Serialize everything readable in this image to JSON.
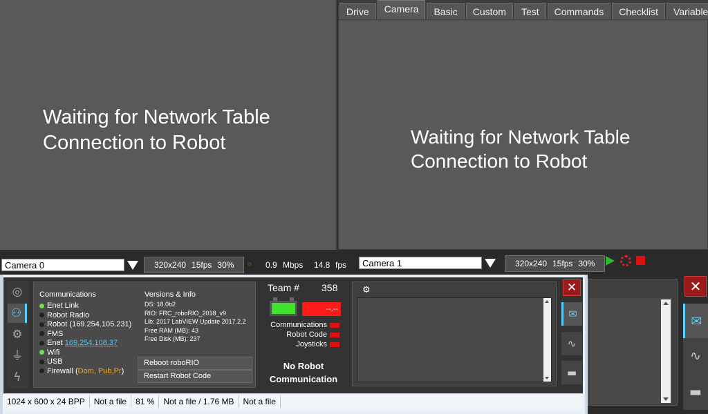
{
  "tabs": [
    "Drive",
    "Camera",
    "Basic",
    "Custom",
    "Test",
    "Commands",
    "Checklist",
    "Variables"
  ],
  "active_tab": "Camera",
  "camera_left": {
    "waiting_line1": "Waiting for Network Table",
    "waiting_line2": "Connection to Robot",
    "select_value": "Camera 0",
    "resolution": "320x240",
    "fps": "15fps",
    "quality": "30%"
  },
  "camera_right": {
    "waiting_line1": "Waiting for Network Table",
    "waiting_line2": "Connection to Robot",
    "select_value": "Camera 1",
    "resolution": "320x240",
    "fps": "15fps",
    "quality": "30%"
  },
  "bandwidth": {
    "value": "0.9",
    "unit": "Mbps",
    "fps_value": "14.8",
    "fps_unit": "fps"
  },
  "communications": {
    "title": "Communications",
    "enet_link": "Enet Link",
    "robot_radio": "Robot Radio",
    "robot": "Robot (169.254.105.231)",
    "fms": "FMS",
    "enet_label": "Enet",
    "enet_ip": "169.254.108.37",
    "wifi": "Wifi",
    "usb": "USB",
    "firewall_label": "Firewall (",
    "firewall_value": "Dom, Pub,Pr",
    "firewall_close": ")"
  },
  "versions": {
    "title": "Versions & Info",
    "ds": "DS:  18.0b2",
    "rio": "RIO:  FRC_roboRIO_2018_v9",
    "lib": "Lib:  2017 LabVIEW Update 2017.2.2",
    "ram": "Free RAM (MB): 43",
    "disk": "Free Disk (MB): 237"
  },
  "buttons": {
    "reboot": "Reboot roboRIO",
    "restart": "Restart Robot Code"
  },
  "team": {
    "label": "Team #",
    "number": "358",
    "voltage": "--.--",
    "comms_label": "Communications",
    "code_label": "Robot Code",
    "joysticks_label": "Joysticks",
    "no_robot_line1": "No Robot",
    "no_robot_line2": "Communication"
  },
  "status_bar": [
    "1024 x 600 x 24 BPP",
    "Not a file",
    "81 %",
    "Not a file / 1.76 MB",
    "Not a file"
  ],
  "icons": {
    "steering": "steering-wheel-icon",
    "comm": "communication-icon",
    "gear": "gear-icon",
    "usb": "usb-icon",
    "power": "power-icon",
    "mail": "mail-icon",
    "chart": "chart-icon",
    "window": "window-icon",
    "close": "close-icon"
  },
  "colors": {
    "accent": "#5ad0ff",
    "ok": "#6fe04a",
    "alert": "#ff1a1a",
    "warn": "#f5a623"
  }
}
